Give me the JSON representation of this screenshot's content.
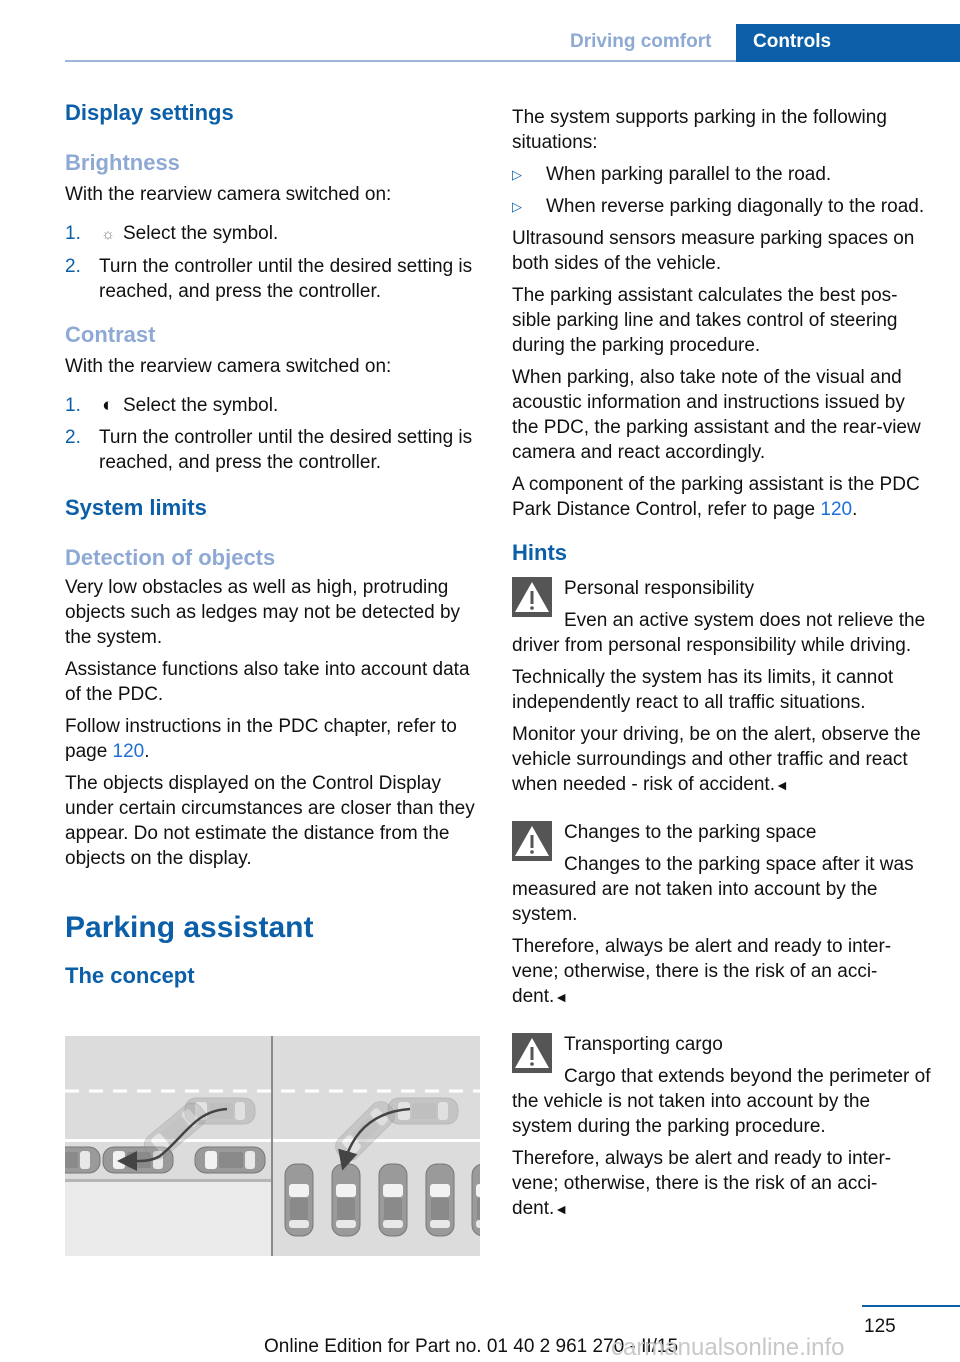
{
  "header": {
    "section": "Driving comfort",
    "tab": "Controls"
  },
  "left": {
    "display_settings": "Display settings",
    "brightness": {
      "heading": "Brightness",
      "intro": "With the rearview camera switched on:",
      "steps": [
        {
          "num": "1.",
          "icon": "☼",
          "text": "Select the symbol."
        },
        {
          "num": "2.",
          "text": "Turn the controller until the desired setting is reached, and press the controller."
        }
      ]
    },
    "contrast": {
      "heading": "Contrast",
      "intro": "With the rearview camera switched on:",
      "steps": [
        {
          "num": "1.",
          "icon": "◐",
          "text": "Select the symbol."
        },
        {
          "num": "2.",
          "text": "Turn the controller until the desired setting is reached, and press the controller."
        }
      ]
    },
    "system_limits": "System limits",
    "detection": {
      "heading": "Detection of objects",
      "p1": "Very low obstacles as well as high, protruding objects such as ledges may not be detected by the system.",
      "p2": "Assistance functions also take into account data of the PDC.",
      "p3_pre": "Follow instructions in the PDC chapter, refer to page ",
      "p3_link": "120",
      "p3_post": ".",
      "p4": "The objects displayed on the Control Display under certain circumstances are closer than they appear. Do not estimate the distance from the objects on the display."
    },
    "parking_assistant": "Parking assistant",
    "the_concept": "The concept",
    "figure_label": "Parking assistant illustration: parallel parking and reverse diagonal parking"
  },
  "right": {
    "intro": "The system supports parking in the following situations:",
    "bullets": [
      "When parking parallel to the road.",
      "When reverse parking diagonally to the road."
    ],
    "p_ultrasound": "Ultrasound sensors measure parking spaces on both sides of the vehicle.",
    "p_calculates": "The parking assistant calculates the best pos-sible parking line and takes control of steering during the parking procedure.",
    "p_note": "When parking, also take note of the visual and acoustic information and instructions issued by the PDC, the parking assistant and the rear-view camera and react accordingly.",
    "p_component_pre": "A component of the parking assistant is the PDC Park Distance Control, refer to page ",
    "p_component_link": "120",
    "p_component_post": ".",
    "hints": "Hints",
    "warnings": [
      {
        "title": "Personal responsibility",
        "paragraphs": [
          "Even an active system does not relieve the driver from personal responsibility while driving.",
          "Technically the system has its limits, it cannot independently react to all traffic situations.",
          "Monitor your driving, be on the alert, observe the vehicle surroundings and other traffic and react when needed - risk of accident."
        ]
      },
      {
        "title": "Changes to the parking space",
        "paragraphs": [
          "Changes to the parking space after it was measured are not taken into account by the system.",
          "Therefore, always be alert and ready to inter-vene; otherwise, there is the risk of an acci-dent."
        ]
      },
      {
        "title": "Transporting cargo",
        "paragraphs": [
          "Cargo that extends beyond the perimeter of the vehicle is not taken into account by the system during the parking procedure.",
          "Therefore, always be alert and ready to inter-vene; otherwise, there is the risk of an acci-dent."
        ]
      }
    ],
    "end_mark": "◄"
  },
  "footer": {
    "page_number": "125",
    "edition": "Online Edition for Part no. 01 40 2 961 270 - II/15",
    "watermark": "carmanualsonline.info"
  }
}
